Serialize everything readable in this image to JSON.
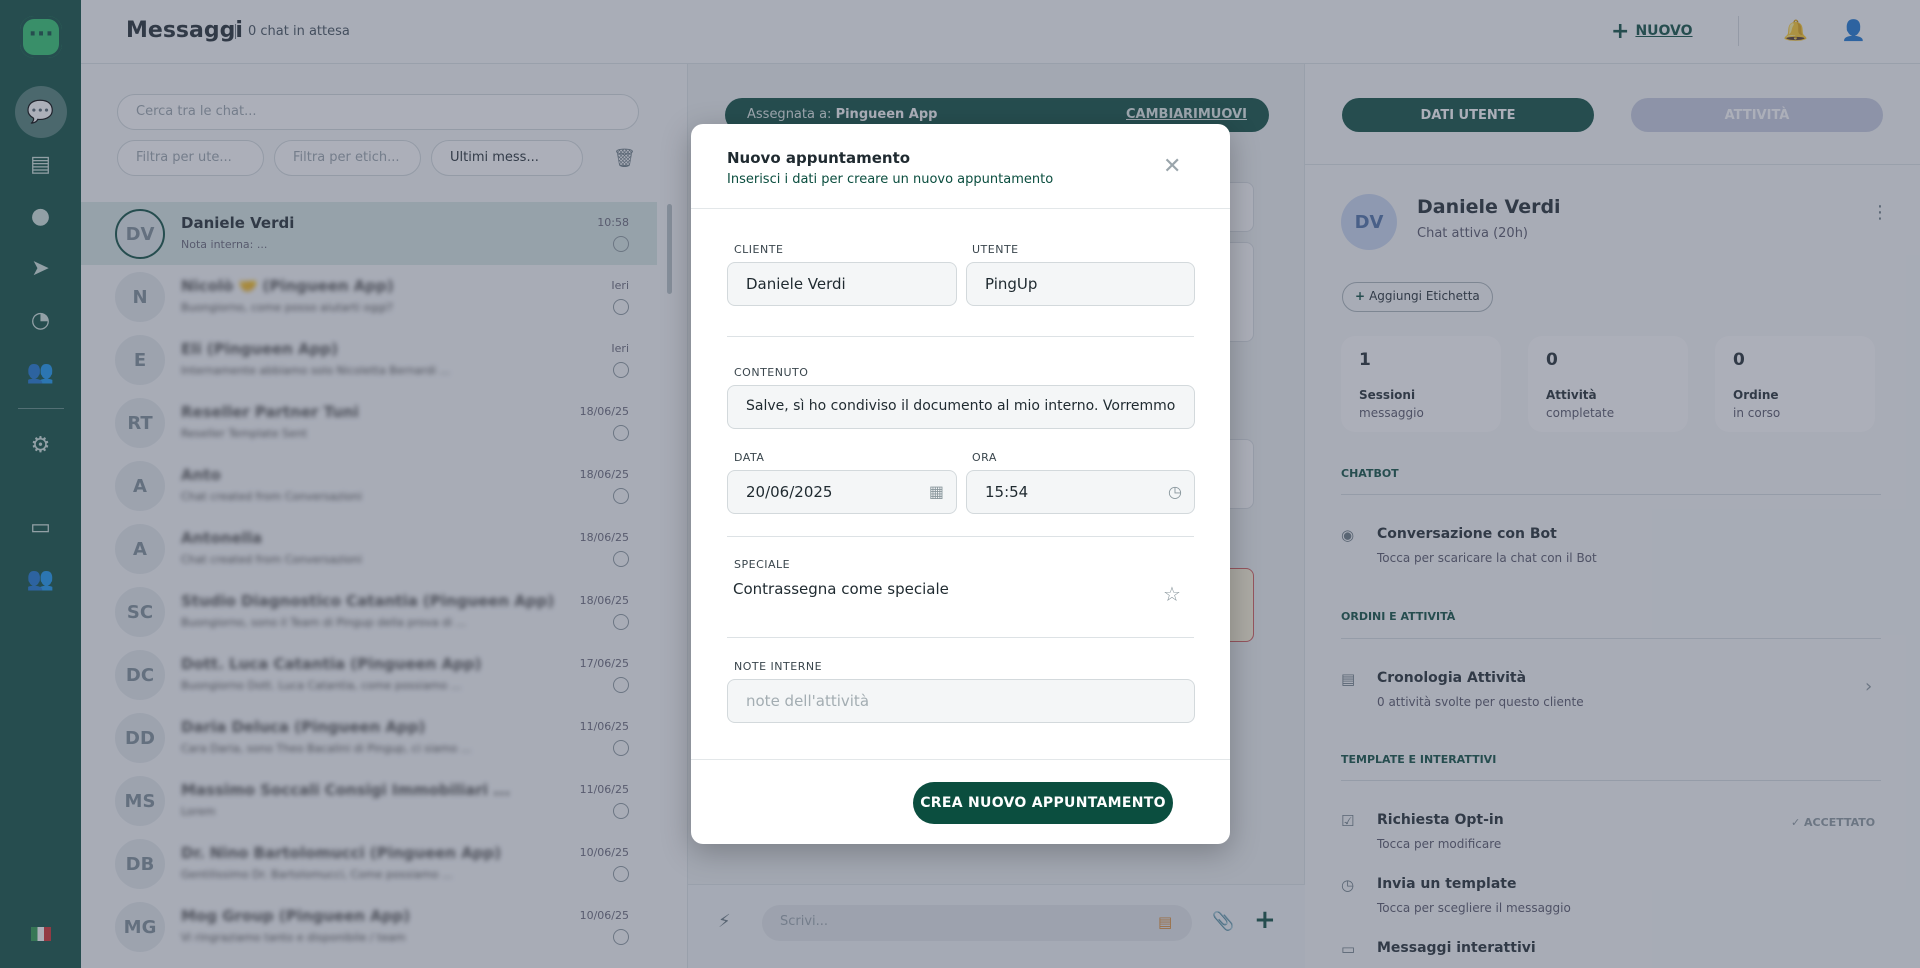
{
  "header": {
    "title": "Messaggi",
    "subtitle": "0 chat in attesa",
    "new_label": "NUOVO"
  },
  "list": {
    "search_placeholder": "Cerca tra le chat...",
    "filters": [
      "Filtra per ute...",
      "Filtra per etich...",
      "Ultimi mess..."
    ],
    "chats": [
      {
        "initials": "DV",
        "name": "Daniele Verdi",
        "preview": "Nota interna: ...",
        "time": "10:58",
        "selected": true
      },
      {
        "initials": "N",
        "name": "Nicolò 🤝 (Pingueen App)",
        "preview": "Buongiorno, come posso aiutarti oggi?",
        "time": "Ieri"
      },
      {
        "initials": "E",
        "name": "Eli (Pingueen App)",
        "preview": "Internamente abbiamo solo Nicoletta Bernardi ...",
        "time": "Ieri"
      },
      {
        "initials": "RT",
        "name": "Reseller Partner Tuni",
        "preview": "Reseller Template Sent",
        "time": "18/06/25"
      },
      {
        "initials": "A",
        "name": "Anto",
        "preview": "Chat created from Conversazioni",
        "time": "18/06/25"
      },
      {
        "initials": "A",
        "name": "Antonella",
        "preview": "Chat created from Conversazioni",
        "time": "18/06/25"
      },
      {
        "initials": "SC",
        "name": "Studio Diagnostico Catantia (Pingueen App)",
        "preview": "Buongiorno, sono il Team di Pingup della prova di ...",
        "time": "18/06/25"
      },
      {
        "initials": "DC",
        "name": "Dott. Luca Catantia (Pingueen App)",
        "preview": "Buongiorno Dott. Luca Catantia, come possiamo ...",
        "time": "17/06/25"
      },
      {
        "initials": "DD",
        "name": "Daria Deluca (Pingueen App)",
        "preview": "Cara Daria, sono Theo Bacalini di Pingup, ci siamo ...",
        "time": "11/06/25"
      },
      {
        "initials": "MS",
        "name": "Massimo Soccali Consigi Immobiliari ...",
        "preview": "Lorem",
        "time": "11/06/25"
      },
      {
        "initials": "DB",
        "name": "Dr. Nino Bartolomucci (Pingueen App)",
        "preview": "Gentilissimo Dr. Bartolomucci, Come possiamo ...",
        "time": "10/06/25"
      },
      {
        "initials": "MG",
        "name": "Mog Group (Pingueen App)",
        "preview": "Vi ringraziamo tanto e disponibile / team",
        "time": "10/06/25"
      }
    ]
  },
  "conversation": {
    "assigned_prefix": "Assegnata a:",
    "assigned_to": "Pingueen App",
    "change_label": "CAMBIA",
    "remove_label": "RIMUOVI",
    "composer_placeholder": "Scrivi..."
  },
  "details": {
    "tab_user": "DATI UTENTE",
    "tab_activity": "ATTIVITÀ",
    "user_initials": "DV",
    "user_name": "Daniele Verdi",
    "user_status": "Chat attiva (20h)",
    "add_tag": "Aggiungi Etichetta",
    "stats": [
      {
        "value": "1",
        "label": "Sessioni",
        "sub": "messaggio"
      },
      {
        "value": "0",
        "label": "Attività",
        "sub": "completate"
      },
      {
        "value": "0",
        "label": "Ordine",
        "sub": "in corso"
      }
    ],
    "section_chatbot": "CHATBOT",
    "bot_title": "Conversazione con Bot",
    "bot_sub": "Tocca per scaricare la chat con il Bot",
    "section_orders": "ORDINI E ATTIVITÀ",
    "history_title": "Cronologia Attività",
    "history_sub": "0 attività svolte per questo cliente",
    "section_templates": "TEMPLATE E INTERATTIVI",
    "optin_title": "Richiesta Opt-in",
    "optin_sub": "Tocca per modificare",
    "optin_status": "ACCETTATO",
    "template_title": "Invia un template",
    "template_sub": "Tocca per scegliere il messaggio",
    "interactive_title": "Messaggi interattivi"
  },
  "modal": {
    "title": "Nuovo appuntamento",
    "subtitle": "Inserisci i dati per creare un nuovo appuntamento",
    "client_label": "CLIENTE",
    "client_value": "Daniele Verdi",
    "user_label": "UTENTE",
    "user_value": "PingUp",
    "content_label": "CONTENUTO",
    "content_value": "Salve, sì ho condiviso il documento al mio interno. Vorremmo",
    "date_label": "DATA",
    "date_value": "20/06/2025",
    "time_label": "ORA",
    "time_value": "15:54",
    "special_label": "SPECIALE",
    "special_text": "Contrassegna come speciale",
    "notes_label": "NOTE INTERNE",
    "notes_placeholder": "note dell'attività",
    "create_label": "CREA NUOVO APPUNTAMENTO"
  }
}
